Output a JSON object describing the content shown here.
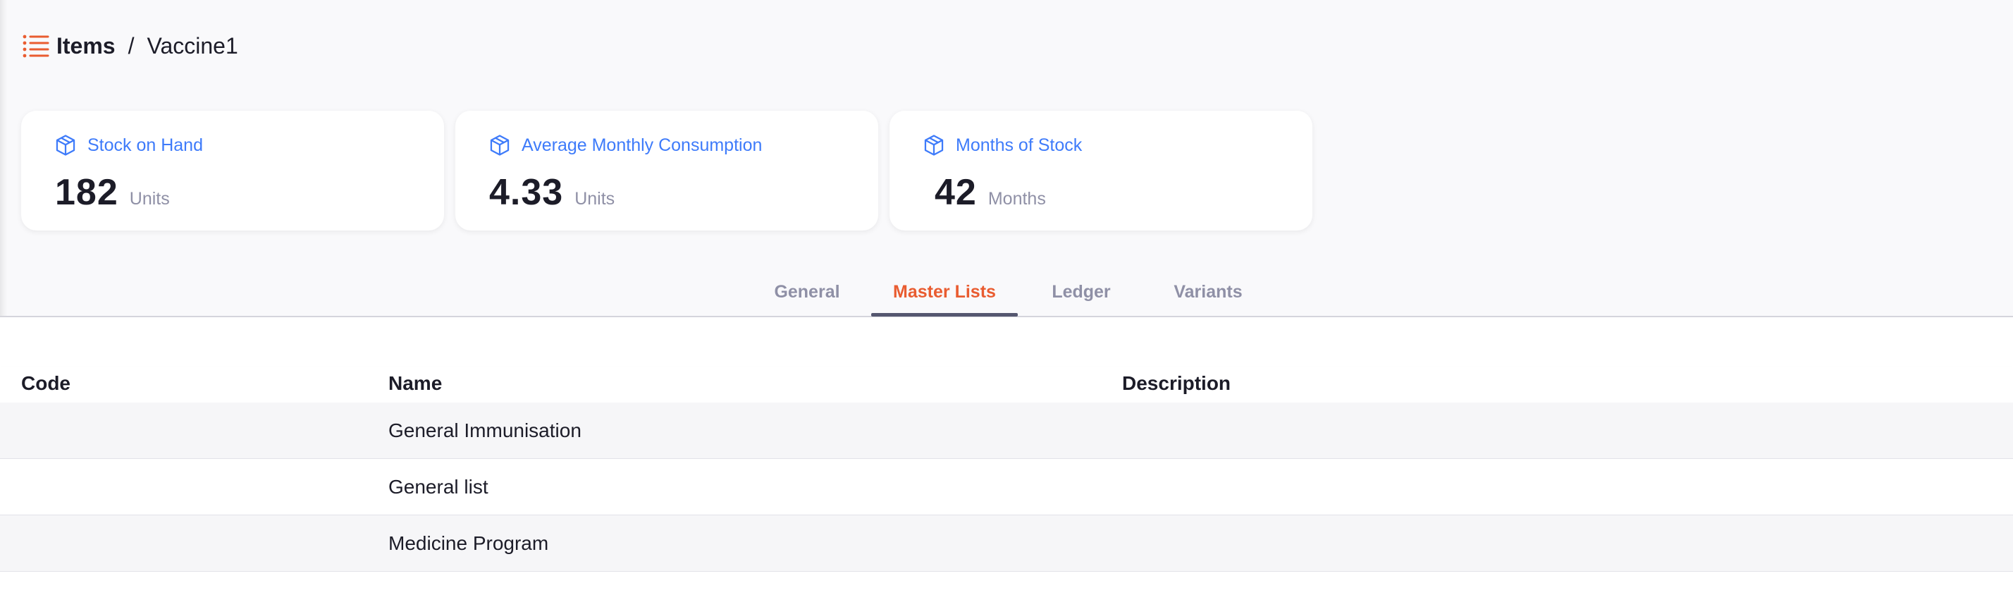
{
  "breadcrumb": {
    "root": "Items",
    "separator": "/",
    "current": "Vaccine1",
    "icon": "list-icon"
  },
  "stats": [
    {
      "label": "Stock on Hand",
      "value": "182",
      "unit": "Units",
      "icon": "package-icon"
    },
    {
      "label": "Average Monthly Consumption",
      "value": "4.33",
      "unit": "Units",
      "icon": "package-icon"
    },
    {
      "label": "Months of Stock",
      "value": "42",
      "unit": "Months",
      "icon": "package-icon"
    }
  ],
  "tabs": [
    {
      "label": "General",
      "active": false
    },
    {
      "label": "Master Lists",
      "active": true
    },
    {
      "label": "Ledger",
      "active": false
    },
    {
      "label": "Variants",
      "active": false
    }
  ],
  "table": {
    "columns": [
      "Code",
      "Name",
      "Description"
    ],
    "rows": [
      {
        "code": "",
        "name": "General Immunisation",
        "description": ""
      },
      {
        "code": "",
        "name": "General list",
        "description": ""
      },
      {
        "code": "",
        "name": "Medicine Program",
        "description": ""
      }
    ]
  },
  "colors": {
    "accent": "#e95c30",
    "link_blue": "#3e7bfa",
    "muted": "#8f90a6",
    "tab_underline": "#555770"
  }
}
